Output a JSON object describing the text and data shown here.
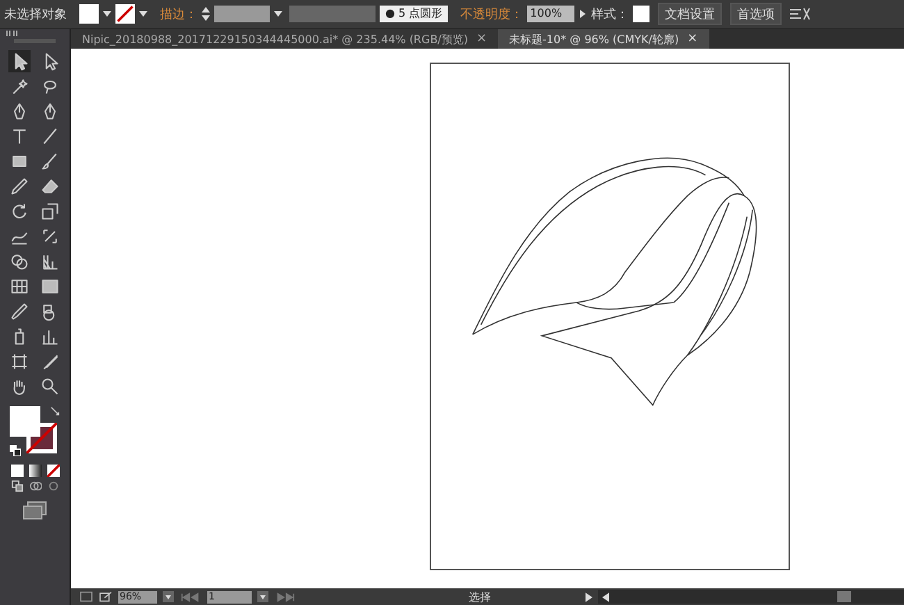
{
  "control_bar": {
    "selection_label": "未选择对象",
    "stroke_label": "描边：",
    "brush_dot": "●",
    "brush_label": "5 点圆形",
    "opacity_label": "不透明度：",
    "opacity_value": "100%",
    "style_label": "样式：",
    "doc_setup_button": "文档设置",
    "preferences_button": "首选项"
  },
  "tabs": [
    {
      "label": "Nipic_20180988_20171229150344445000.ai* @ 235.44% (RGB/预览)",
      "close": "×",
      "selected": false
    },
    {
      "label": "未标题-10* @ 96% (CMYK/轮廓)",
      "close": "×",
      "selected": true
    }
  ],
  "status_bar": {
    "zoom": "96%",
    "page": "1",
    "tool": "选择"
  }
}
